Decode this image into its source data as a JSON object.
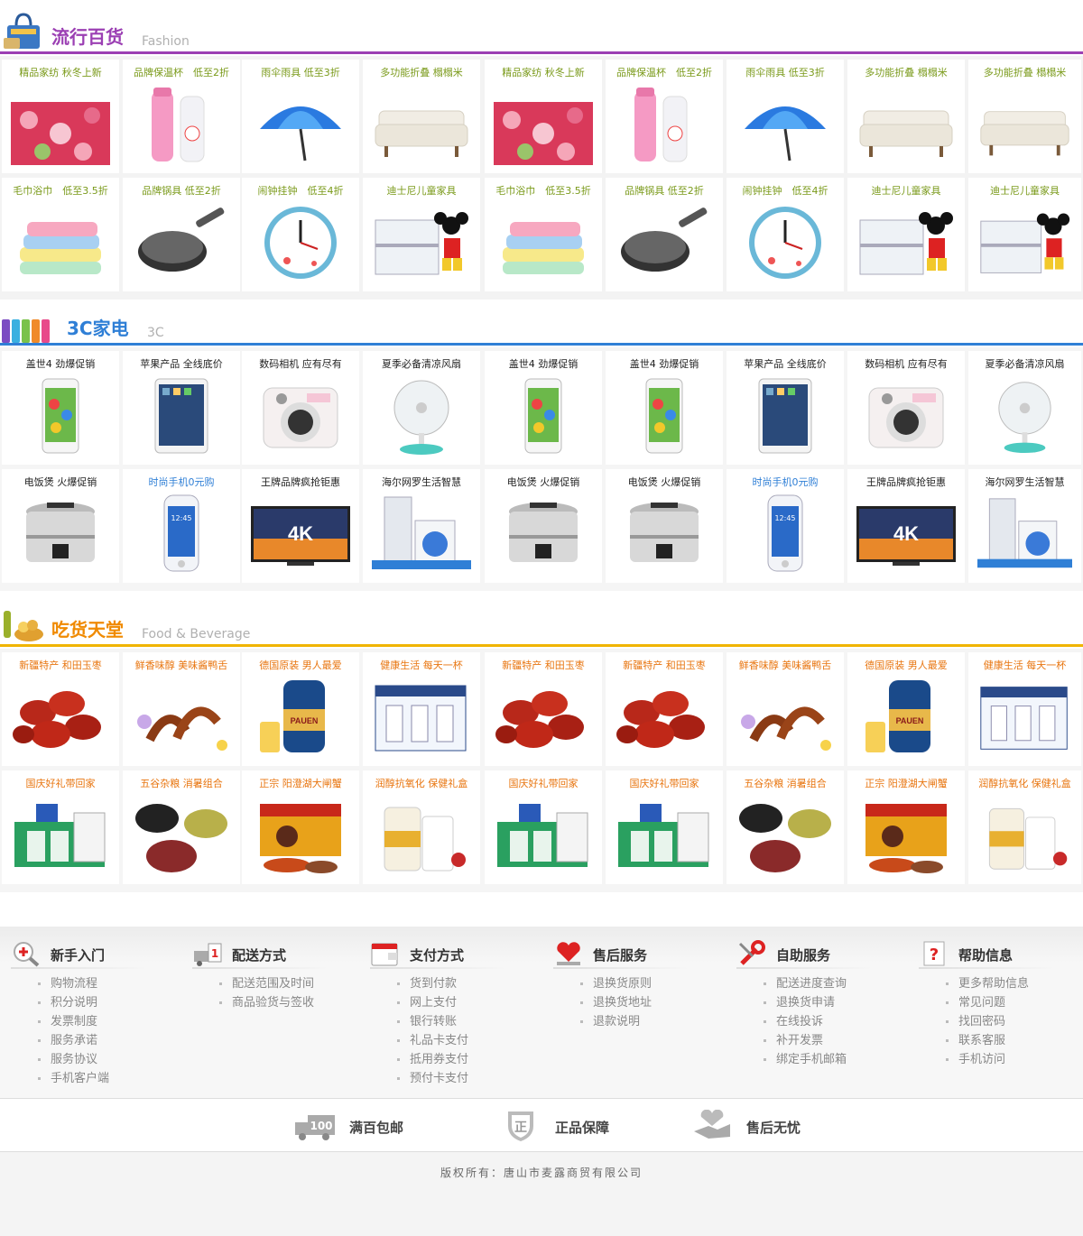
{
  "sections": [
    {
      "id": "fashion",
      "title": "流行百货",
      "subtitle": "Fashion",
      "color": "#9b3fb3",
      "label_color": "#7a9a1a",
      "rows": [
        [
          "精品家纺 秋冬上新",
          "品牌保温杯　低至2折",
          "雨伞雨具 低至3折",
          "多功能折叠 榻榻米",
          "精品家纺 秋冬上新",
          "品牌保温杯　低至2折",
          "雨伞雨具 低至3折",
          "多功能折叠 榻榻米",
          "多功能折叠 榻榻米"
        ],
        [
          "毛巾浴巾　低至3.5折",
          "品牌锅具 低至2折",
          "闹钟挂钟　低至4折",
          "迪士尼儿童家具",
          "毛巾浴巾　低至3.5折",
          "品牌锅具 低至2折",
          "闹钟挂钟　低至4折",
          "迪士尼儿童家具",
          "迪士尼儿童家具"
        ]
      ],
      "images": [
        [
          "bedding-image",
          "thermos-image",
          "umbrella-image",
          "sofa-image",
          "bedding-image",
          "thermos-image",
          "umbrella-image",
          "sofa-image",
          "sofa-image"
        ],
        [
          "towels-image",
          "pan-image",
          "clock-image",
          "kids-bed-image",
          "towels-image",
          "pan-image",
          "clock-image",
          "kids-bed-image",
          "kids-bed-image"
        ]
      ]
    },
    {
      "id": "electronics",
      "title": "3C家电",
      "subtitle": "3C",
      "color": "#2f7fd6",
      "label_color": "#222222",
      "rows": [
        [
          "盖世4 劲爆促销",
          "苹果产品 全线底价",
          "数码相机 应有尽有",
          "夏季必备清凉风扇",
          "盖世4 劲爆促销",
          "盖世4 劲爆促销",
          "苹果产品 全线底价",
          "数码相机 应有尽有",
          "夏季必备清凉风扇"
        ],
        [
          "电饭煲 火爆促销",
          "时尚手机0元购",
          "王牌品牌疯抢钜惠",
          "海尔网罗生活智慧",
          "电饭煲 火爆促销",
          "电饭煲 火爆促销",
          "时尚手机0元购",
          "王牌品牌疯抢钜惠",
          "海尔网罗生活智慧"
        ]
      ],
      "images": [
        [
          "smartphone-image",
          "tablet-image",
          "camera-image",
          "fan-image",
          "smartphone-image",
          "smartphone-image",
          "tablet-image",
          "camera-image",
          "fan-image"
        ],
        [
          "rice-cooker-image",
          "phone-image",
          "tv-4k-image",
          "appliances-image",
          "rice-cooker-image",
          "rice-cooker-image",
          "phone-image",
          "tv-4k-image",
          "appliances-image"
        ]
      ],
      "tv_text": "4K",
      "phone_time": "12:45"
    },
    {
      "id": "food",
      "title": "吃货天堂",
      "subtitle": "Food & Beverage",
      "color": "#f0a500",
      "label_color": "#e8750f",
      "rows": [
        [
          "新疆特产 和田玉枣",
          "鲜香味醇 美味酱鸭舌",
          "德国原装 男人最爱",
          "健康生活 每天一杯",
          "新疆特产 和田玉枣",
          "新疆特产 和田玉枣",
          "鲜香味醇 美味酱鸭舌",
          "德国原装 男人最爱",
          "健康生活 每天一杯"
        ],
        [
          "国庆好礼带回家",
          "五谷杂粮 消暑组合",
          "正宗 阳澄湖大闸蟹",
          "润醇抗氧化 保健礼盒",
          "国庆好礼带回家",
          "国庆好礼带回家",
          "五谷杂粮 消暑组合",
          "正宗 阳澄湖大闸蟹",
          "润醇抗氧化 保健礼盒"
        ]
      ],
      "images": [
        [
          "dates-image",
          "duck-tongue-image",
          "beer-keg-image",
          "milk-box-image",
          "dates-image",
          "dates-image",
          "duck-tongue-image",
          "beer-keg-image",
          "milk-box-image"
        ],
        [
          "gift-box-image",
          "grains-image",
          "crab-box-image",
          "supplements-image",
          "gift-box-image",
          "gift-box-image",
          "grains-image",
          "crab-box-image",
          "supplements-image"
        ]
      ],
      "beer_text": "PAUEN"
    }
  ],
  "help": [
    {
      "title": "新手入门",
      "icon": "magnifier-plus-icon",
      "items": [
        "购物流程",
        "积分说明",
        "发票制度",
        "服务承诺",
        "服务协议",
        "手机客户端"
      ]
    },
    {
      "title": "配送方式",
      "icon": "delivery-truck-icon",
      "items": [
        "配送范围及时间",
        "商品验货与签收"
      ]
    },
    {
      "title": "支付方式",
      "icon": "wallet-icon",
      "items": [
        "货到付款",
        "网上支付",
        "银行转账",
        "礼品卡支付",
        "抵用券支付",
        "预付卡支付"
      ]
    },
    {
      "title": "售后服务",
      "icon": "heart-hand-icon",
      "items": [
        "退换货原则",
        "退换货地址",
        "退款说明"
      ]
    },
    {
      "title": "自助服务",
      "icon": "wrench-icon",
      "items": [
        "配送进度查询",
        "退换货申请",
        "在线投诉",
        "补开发票",
        "绑定手机邮箱"
      ]
    },
    {
      "title": "帮助信息",
      "icon": "question-doc-icon",
      "items": [
        "更多帮助信息",
        "常见问题",
        "找回密码",
        "联系客服",
        "手机访问"
      ]
    }
  ],
  "promises": [
    {
      "label": "满百包邮",
      "icon": "truck-100-icon",
      "badge": "100"
    },
    {
      "label": "正品保障",
      "icon": "shield-zheng-icon",
      "badge": "正"
    },
    {
      "label": "售后无忧",
      "icon": "handshake-heart-icon"
    }
  ],
  "copyright": "版权所有：唐山市麦露商贸有限公司"
}
